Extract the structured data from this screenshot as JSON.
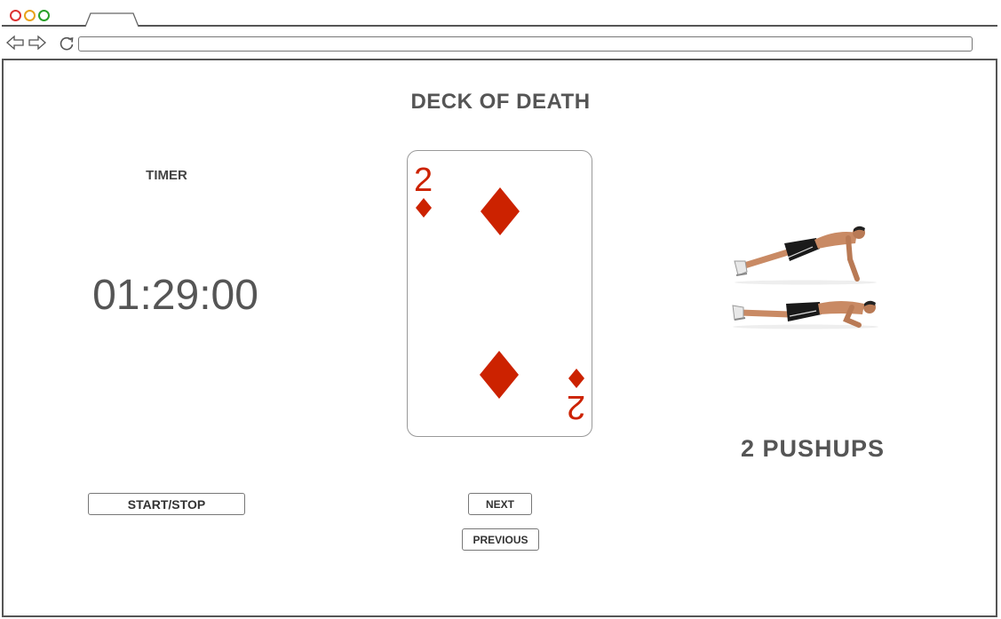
{
  "page": {
    "title": "DECK OF DEATH"
  },
  "timer": {
    "label": "TIMER",
    "value": "01:29:00",
    "start_stop_label": "START/STOP"
  },
  "card": {
    "rank": "2",
    "suit": "diamonds",
    "suit_color": "#cc2200"
  },
  "navigation": {
    "next_label": "NEXT",
    "previous_label": "PREVIOUS"
  },
  "exercise": {
    "reps_label": "2 PUSHUPS",
    "image": "pushup-illustration"
  }
}
